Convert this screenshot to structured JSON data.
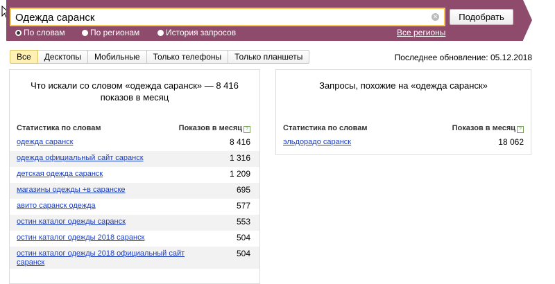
{
  "search": {
    "query": "Одежда саранск",
    "submit_label": "Подобрать",
    "modes": [
      "По словам",
      "По регионам",
      "История запросов"
    ],
    "regions_link": "Все регионы"
  },
  "tabs": [
    "Все",
    "Десктопы",
    "Мобильные",
    "Только телефоны",
    "Только планшеты"
  ],
  "active_tab": "Все",
  "updated": "Последнее обновление: 05.12.2018",
  "left_panel": {
    "title": "Что искали со словом «одежда саранск» — 8 416 показов в месяц",
    "col_words": "Статистика по словам",
    "col_count": "Показов в месяц",
    "rows": [
      {
        "phrase": "одежда саранск",
        "count": "8 416"
      },
      {
        "phrase": "одежда официальный сайт саранск",
        "count": "1 316"
      },
      {
        "phrase": "детская одежда саранск",
        "count": "1 209"
      },
      {
        "phrase": "магазины одежды +в саранске",
        "count": "695"
      },
      {
        "phrase": "авито саранск одежда",
        "count": "577"
      },
      {
        "phrase": "остин каталог одежды саранск",
        "count": "553"
      },
      {
        "phrase": "остин каталог одежды 2018 саранск",
        "count": "504"
      },
      {
        "phrase": "остин каталог одежды 2018 официальный сайт саранск",
        "count": "504"
      }
    ]
  },
  "right_panel": {
    "title": "Запросы, похожие на «одежда саранск»",
    "col_words": "Статистика по словам",
    "col_count": "Показов в месяц",
    "rows": [
      {
        "phrase": "эльдорадо саранск",
        "count": "18 062"
      }
    ]
  },
  "colors": {
    "band": "#8e4b6c",
    "link": "#1a3dc1",
    "active_tab": "#fff0b3",
    "search_border": "#f2c94c"
  },
  "icons": [
    "cursor-icon",
    "clear-icon",
    "help-icon"
  ]
}
